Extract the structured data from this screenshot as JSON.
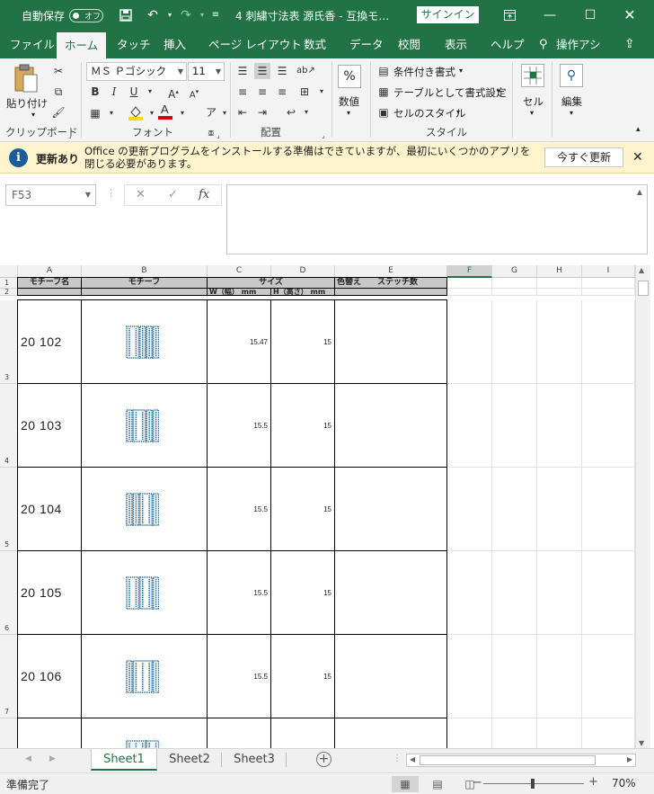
{
  "titlebar": {
    "autosave_label": "自動保存",
    "autosave_state": "オフ",
    "quick_access_more": "≡",
    "document_title": "4 刺繍寸法表  源氏香  -  互換モ…",
    "signin_label": "サインイン"
  },
  "tabs": [
    {
      "label": "ファイル"
    },
    {
      "label": "ホーム"
    },
    {
      "label": "タッチ"
    },
    {
      "label": "挿入"
    },
    {
      "label": "ページ レイアウト"
    },
    {
      "label": "数式"
    },
    {
      "label": "データ"
    },
    {
      "label": "校閲"
    },
    {
      "label": "表示"
    },
    {
      "label": "ヘルプ"
    },
    {
      "label": "操作アシ"
    }
  ],
  "ribbon": {
    "clipboard": {
      "paste_label": "貼り付け",
      "group_label": "クリップボード"
    },
    "font": {
      "font_name": "ＭＳ Ｐゴシック",
      "font_size": "11",
      "group_label": "フォント"
    },
    "alignment": {
      "group_label": "配置"
    },
    "number": {
      "label": "数値"
    },
    "styles": {
      "conditional": "条件付き書式",
      "table": "テーブルとして書式設定",
      "cell_style": "セルのスタイル",
      "group_label": "スタイル"
    },
    "cells": {
      "label": "セル"
    },
    "editing": {
      "label": "編集"
    }
  },
  "notification": {
    "title": "更新あり",
    "message": "Office の更新プログラムをインストールする準備はできていますが、最初にいくつかのアプリを閉じる必要があります。",
    "button": "今すぐ更新"
  },
  "formula_bar": {
    "name_box": "F53",
    "formula": ""
  },
  "sheet": {
    "columns": [
      "A",
      "B",
      "C",
      "D",
      "E",
      "F",
      "G",
      "H",
      "I"
    ],
    "selected_column": "F",
    "header1": {
      "a": "モチーフ名",
      "b": "モチーフ",
      "cd": "サイズ",
      "e": "色替え　　ステッチ数"
    },
    "header2": {
      "c": "W（幅） mm",
      "d": "H（高さ） mm"
    },
    "rows": [
      {
        "num": "3",
        "code": "20 102",
        "w": "15.47",
        "h": "15"
      },
      {
        "num": "4",
        "code": "20 103",
        "w": "15.5",
        "h": "15"
      },
      {
        "num": "5",
        "code": "20 104",
        "w": "15.5",
        "h": "15"
      },
      {
        "num": "6",
        "code": "20 105",
        "w": "15.5",
        "h": "15"
      },
      {
        "num": "7",
        "code": "20 106",
        "w": "15.5",
        "h": "15"
      }
    ],
    "header_row_nums": [
      "1",
      "2"
    ]
  },
  "sheet_tabs": [
    {
      "label": "Sheet1"
    },
    {
      "label": "Sheet2"
    },
    {
      "label": "Sheet3"
    }
  ],
  "status": {
    "ready": "準備完了",
    "zoom": "70%"
  },
  "colors": {
    "brand": "#217346",
    "motif": "#2b6f9a",
    "notify_bg": "#fff4ce"
  }
}
